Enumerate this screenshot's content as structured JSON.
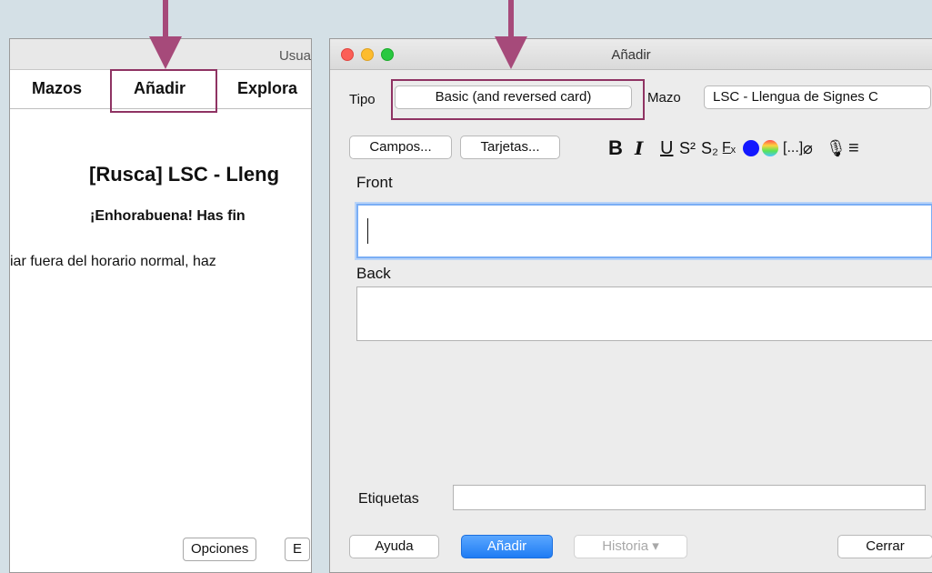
{
  "left_window": {
    "title": "Usua",
    "nav": {
      "decks": "Mazos",
      "add": "Añadir",
      "browse": "Explora"
    },
    "deck_title": "[Rusca] LSC - Lleng",
    "congrats": "¡Enhorabuena! Has fin",
    "study_more": "iar fuera del horario normal, haz",
    "buttons": {
      "options": "Opciones",
      "e": "E"
    }
  },
  "add_dialog": {
    "title": "Añadir",
    "type_label": "Tipo",
    "type_value": "Basic (and reversed card)",
    "deck_label": "Mazo",
    "deck_value": "LSC - Llengua de Signes C",
    "fields_button": "Campos...",
    "cards_button": "Tarjetas...",
    "toolbar": {
      "bold": "B",
      "italic": "I",
      "underline": "U",
      "superscript": "S²",
      "subscript": "S₂",
      "clear_format": "F̲ₓ",
      "cloze": "[...]",
      "attach": "⌀",
      "record": "🎙",
      "more": "≡"
    },
    "fields": [
      {
        "name": "Front",
        "value": ""
      },
      {
        "name": "Back",
        "value": ""
      }
    ],
    "tags_label": "Etiquetas",
    "tags_value": "",
    "buttons": {
      "help": "Ayuda",
      "add": "Añadir",
      "history": "Historia ▾",
      "close": "Cerrar"
    }
  },
  "colors": {
    "highlight": "#8f3363",
    "accent": "#1f7cf4",
    "text_color": "#1318ff"
  }
}
